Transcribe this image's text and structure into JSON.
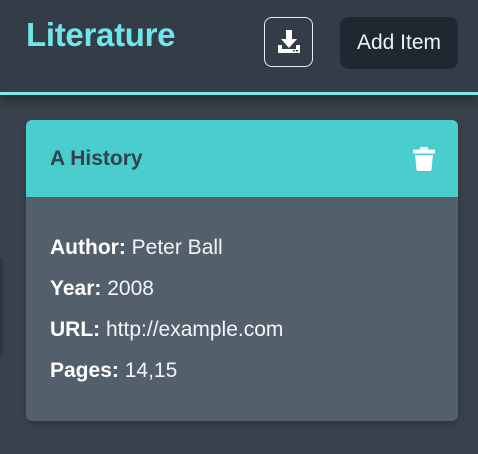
{
  "header": {
    "title": "Literature",
    "download_icon": "download-icon",
    "add_button_label": "Add Item"
  },
  "card": {
    "title": "A History",
    "delete_icon": "trash-icon",
    "fields": [
      {
        "label": "Author:",
        "value": "Peter Ball"
      },
      {
        "label": "Year:",
        "value": "2008"
      },
      {
        "label": "URL:",
        "value": "http://example.com"
      },
      {
        "label": "Pages:",
        "value": "14,15"
      }
    ]
  },
  "colors": {
    "accent": "#6fe7ea",
    "card_header": "#49cdcd",
    "card_body": "#535f6b",
    "header_bg": "#343d47"
  }
}
